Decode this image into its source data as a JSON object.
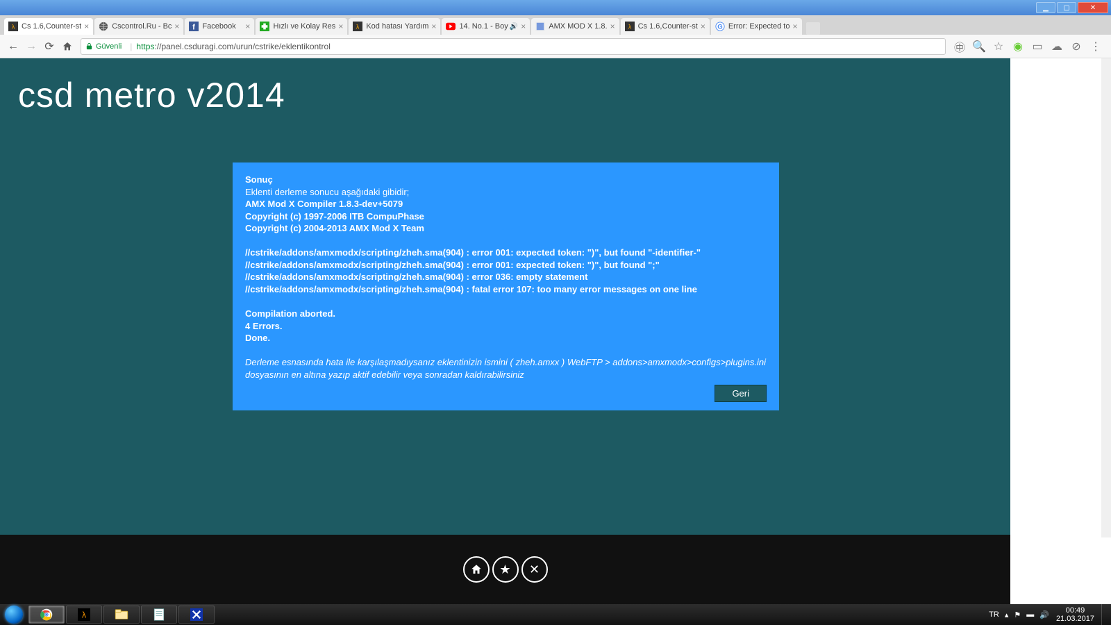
{
  "window_buttons": {
    "min": "▁",
    "max": "▢",
    "close": "✕"
  },
  "tabs": [
    {
      "label": "Cs 1.6,Counter-st",
      "icon": "cs",
      "active": true
    },
    {
      "label": "Cscontrol.Ru - Bc",
      "icon": "globe"
    },
    {
      "label": "Facebook",
      "icon": "fb"
    },
    {
      "label": "Hızlı ve Kolay Res",
      "icon": "green"
    },
    {
      "label": "Kod hatası Yardım",
      "icon": "cs"
    },
    {
      "label": "14. No.1 - Boy",
      "icon": "yt",
      "sound": true
    },
    {
      "label": "AMX MOD X 1.8.",
      "icon": "amx"
    },
    {
      "label": "Cs 1.6,Counter-st",
      "icon": "cs"
    },
    {
      "label": "Error: Expected to",
      "icon": "g"
    }
  ],
  "omnibox": {
    "secure_label": "Güvenli",
    "https": "https",
    "rest": "://panel.csduragi.com/urun/cstrike/eklentikontrol"
  },
  "page": {
    "title": "csd metro v2014",
    "panel": {
      "result_heading": "Sonuç",
      "intro": "Eklenti derleme sonucu aşağıdaki gibidir;",
      "lines": [
        "AMX Mod X Compiler 1.8.3-dev+5079",
        "Copyright (c) 1997-2006 ITB CompuPhase",
        "Copyright (c) 2004-2013 AMX Mod X Team"
      ],
      "errors": [
        "//cstrike/addons/amxmodx/scripting/zheh.sma(904) : error 001: expected token: \")\", but found \"-identifier-\"",
        "//cstrike/addons/amxmodx/scripting/zheh.sma(904) : error 001: expected token: \")\", but found \";\"",
        "//cstrike/addons/amxmodx/scripting/zheh.sma(904) : error 036: empty statement",
        "//cstrike/addons/amxmodx/scripting/zheh.sma(904) : fatal error 107: too many error messages on one line"
      ],
      "footer": [
        "Compilation aborted.",
        "4 Errors.",
        "Done."
      ],
      "note": "Derleme esnasında hata ile karşılaşmadıysanız eklentinizin ismini ( zheh.amxx ) WebFTP > addons>amxmodx>configs>plugins.ini dosyasının en altına yazıp aktif edebilir veya sonradan kaldırabilirsiniz",
      "back_label": "Geri"
    },
    "footer_icons": [
      "home",
      "star",
      "close"
    ]
  },
  "taskbar": {
    "items": [
      "chrome",
      "hl",
      "explorer",
      "notepad",
      "xfire"
    ],
    "lang": "TR",
    "tray_up": "▴",
    "flag": "⚑",
    "net": "▬",
    "vol": "🔊",
    "time": "00:49",
    "date": "21.03.2017"
  }
}
